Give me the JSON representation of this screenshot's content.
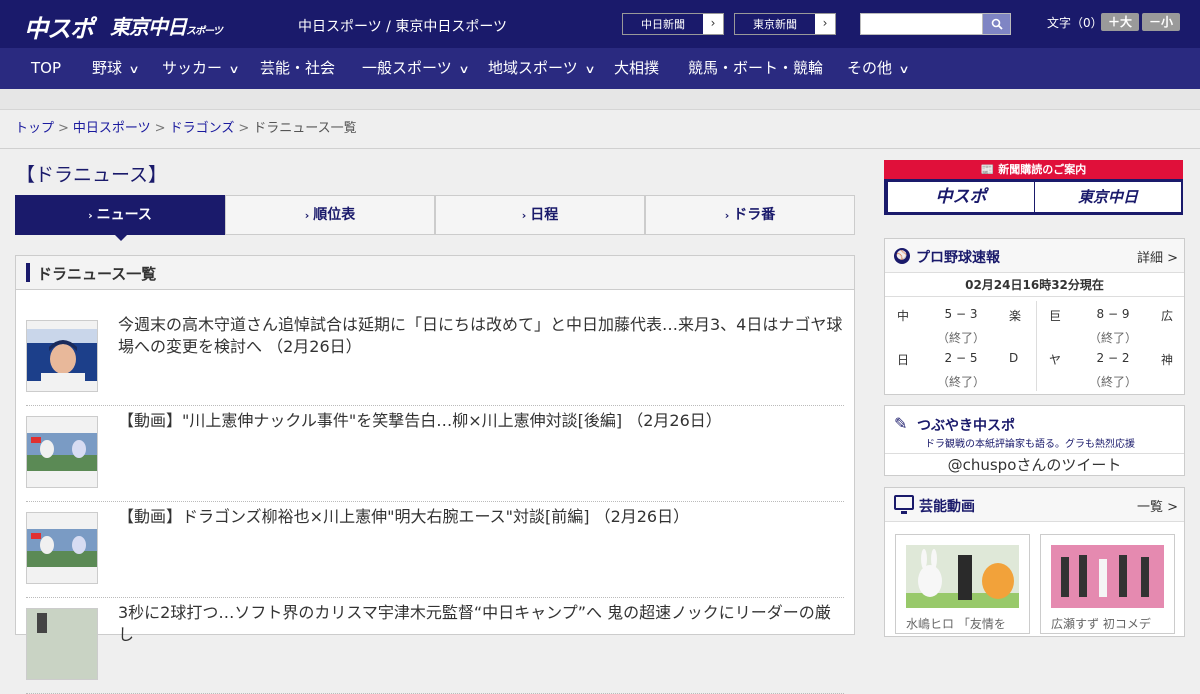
{
  "header": {
    "logo_chuspo": "中スポ",
    "logo_tokyo": "東京中日",
    "logo_tokyo_small": "スポーツ",
    "site_title": "中日スポーツ / 東京中日スポーツ",
    "btn_chunichi": "中日新聞",
    "btn_tokyo": "東京新聞",
    "search_placeholder": "",
    "fontsize_label": "文字（0）",
    "fs_large": "＋大",
    "fs_small": "－小"
  },
  "nav": {
    "items": [
      {
        "label": "TOP"
      },
      {
        "label": "野球"
      },
      {
        "label": "サッカー"
      },
      {
        "label": "芸能・社会"
      },
      {
        "label": "一般スポーツ"
      },
      {
        "label": "地域スポーツ"
      },
      {
        "label": "大相撲"
      },
      {
        "label": "競馬・ボート・競輪"
      },
      {
        "label": "その他"
      }
    ]
  },
  "breadcrumb": {
    "items": [
      "トップ",
      "中日スポーツ",
      "ドラゴンズ"
    ],
    "current": "ドラニュース一覧",
    "sep": ">"
  },
  "page": {
    "title": "【ドラニュース】",
    "tabs": [
      {
        "label": "ニュース"
      },
      {
        "label": "順位表"
      },
      {
        "label": "日程"
      },
      {
        "label": "ドラ番"
      }
    ],
    "news_header": "ドラニュース一覧",
    "news": [
      {
        "text": "今週末の高木守道さん追悼試合は延期に「日にちは改めて」と中日加藤代表…来月3、4日はナゴヤ球場への変更を検討へ （2月26日）"
      },
      {
        "text": "【動画】\"川上憲伸ナックル事件\"を笑撃告白…柳×川上憲伸対談[後編] （2月26日）"
      },
      {
        "text": "【動画】ドラゴンズ柳裕也×川上憲伸\"明大右腕エース\"対談[前編] （2月26日）"
      },
      {
        "text": "3秒に2球打つ…ソフト界のカリスマ宇津木元監督“中日キャンプ”へ 鬼の超速ノックにリーダーの厳し"
      }
    ]
  },
  "sidebar": {
    "subscribe_title": "新聞購読のご案内",
    "subscribe_chuspo": "中スポ",
    "subscribe_tokyo": "東京中日",
    "baseball": {
      "title": "プロ野球速報",
      "link": "詳細 >",
      "icon": "baseball-icon",
      "time": "02月24日16時32分現在",
      "games": [
        {
          "home": "中",
          "score": "5 − 3",
          "away": "楽",
          "status": "（終了）"
        },
        {
          "home": "巨",
          "score": "8 − 9",
          "away": "広",
          "status": "（終了）"
        },
        {
          "home": "日",
          "score": "2 − 5",
          "away": "D",
          "status": "（終了）"
        },
        {
          "home": "ヤ",
          "score": "2 − 2",
          "away": "神",
          "status": "（終了）"
        }
      ]
    },
    "tweet": {
      "title": "つぶやき中スポ",
      "sub": "ドラ観戦の本紙評論家も語る。グラも熱烈応援",
      "link": "@chuspoさんのツイート"
    },
    "video": {
      "title": "芸能動画",
      "link": "一覧 >",
      "cards": [
        {
          "caption": "水嶋ヒロ 「友情を"
        },
        {
          "caption": "広瀬すず 初コメデ"
        }
      ]
    }
  },
  "colors": {
    "header_bg": "#1a1a6b",
    "nav_bg": "#2a2a80",
    "accent_red": "#e0103a"
  }
}
